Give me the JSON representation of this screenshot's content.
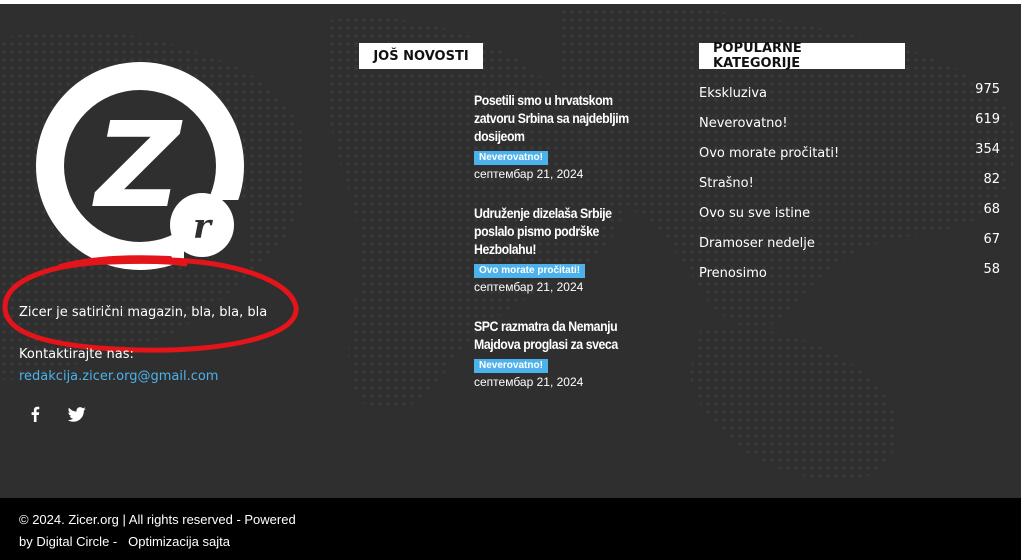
{
  "about": {
    "logo_letter": "Z",
    "logo_sub_letter": "r",
    "description": "Zicer je satirični magazin, bla, bla, bla",
    "contact_label": "Kontaktirajte nas:",
    "contact_email": "redakcija.zicer.org@gmail.com",
    "social": [
      {
        "name": "facebook-icon",
        "glyph": "f"
      },
      {
        "name": "twitter-icon"
      }
    ],
    "highlight_color": "#e3141a"
  },
  "news": {
    "title": "JOŠ NOVOSTI",
    "items": [
      {
        "title": "Posetili smo u hrvatskom zatvoru Srbina sa najdebljim dosijeom",
        "tag": "Neverovatno!",
        "date": "септембар 21, 2024"
      },
      {
        "title": "Udruženje dizelaša Srbije poslalo pismo podrške Hezbolahu!",
        "tag": "Ovo morate pročitati!",
        "date": "септембар 21, 2024"
      },
      {
        "title": "SPC razmatra da Nemanju Majdova proglasi za sveca",
        "tag": "Neverovatno!",
        "date": "септембар 21, 2024"
      }
    ]
  },
  "categories": {
    "title": "POPULARNE KATEGORIJE",
    "items": [
      {
        "name": "Ekskluziva",
        "count": "975"
      },
      {
        "name": "Neverovatno!",
        "count": "619"
      },
      {
        "name": "Ovo morate pročitati!",
        "count": "354"
      },
      {
        "name": "Strašno!",
        "count": "82"
      },
      {
        "name": "Ovo su sve istine",
        "count": "68"
      },
      {
        "name": "Dramoser nedelje",
        "count": "67"
      },
      {
        "name": "Prenosimo",
        "count": "58"
      }
    ]
  },
  "bottom": {
    "line1": "© 2024. Zicer.org | All rights reserved - Powered",
    "line2_prefix": "by ",
    "powered_by": "Digital Circle",
    "separator": " - ",
    "seo_link": "Optimizacija sajta"
  },
  "colors": {
    "footer_bg": "#2f2f2f",
    "accent": "#4db2ec",
    "bottom_bg": "#000000"
  }
}
